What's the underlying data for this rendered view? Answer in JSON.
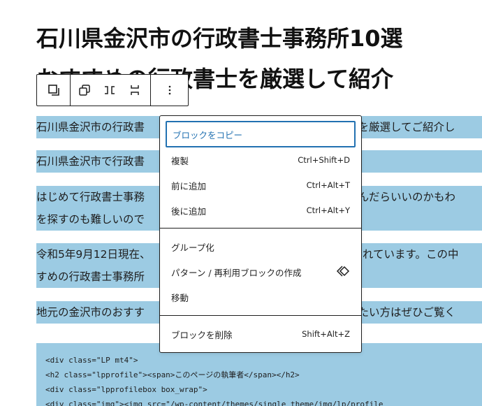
{
  "post": {
    "title_line1": "石川県金沢市の行政書士事務所10選",
    "title_line2": "おすすめの行政書士を厳選して紹介",
    "paragraphs": [
      [
        "石川県金沢市の行政書",
        "所を厳選してご紹介し"
      ],
      [
        "石川県金沢市で行政書"
      ],
      [
        "はじめて行政書士事務",
        "選んだらいいのかもわ",
        "を探すのも難しいので"
      ],
      [
        "令和5年9月12日現在、",
        "されています。この中",
        "すめの行政書士事務所"
      ],
      [
        "地元の金沢市のおすす",
        "りたい方はぜひご覧く"
      ]
    ],
    "code_lines": [
      "<div class=\"LP mt4\">",
      "<h2 class=\"lpprofile\"><span>このページの執筆者</span></h2>",
      "<div class=\"lpprofilebox box_wrap\">",
      "<div class=\"img\"><img src=\"/wp-content/themes/single_theme/img/lp/profile"
    ]
  },
  "toolbar": {
    "icons": [
      "block-type-icon",
      "duplicate-icon",
      "align-horizontal-icon",
      "align-vertical-icon",
      "more-options-icon"
    ]
  },
  "menu": {
    "copy_block": "ブロックをコピー",
    "duplicate": "複製",
    "duplicate_shortcut": "Ctrl+Shift+D",
    "insert_before": "前に追加",
    "insert_before_shortcut": "Ctrl+Alt+T",
    "insert_after": "後に追加",
    "insert_after_shortcut": "Ctrl+Alt+Y",
    "group": "グループ化",
    "create_pattern": "パターン / 再利用ブロックの作成",
    "move": "移動",
    "delete_block": "ブロックを削除",
    "delete_shortcut": "Shift+Alt+Z"
  },
  "colors": {
    "selection": "#9ccbe3",
    "focus": "#2271b1"
  }
}
